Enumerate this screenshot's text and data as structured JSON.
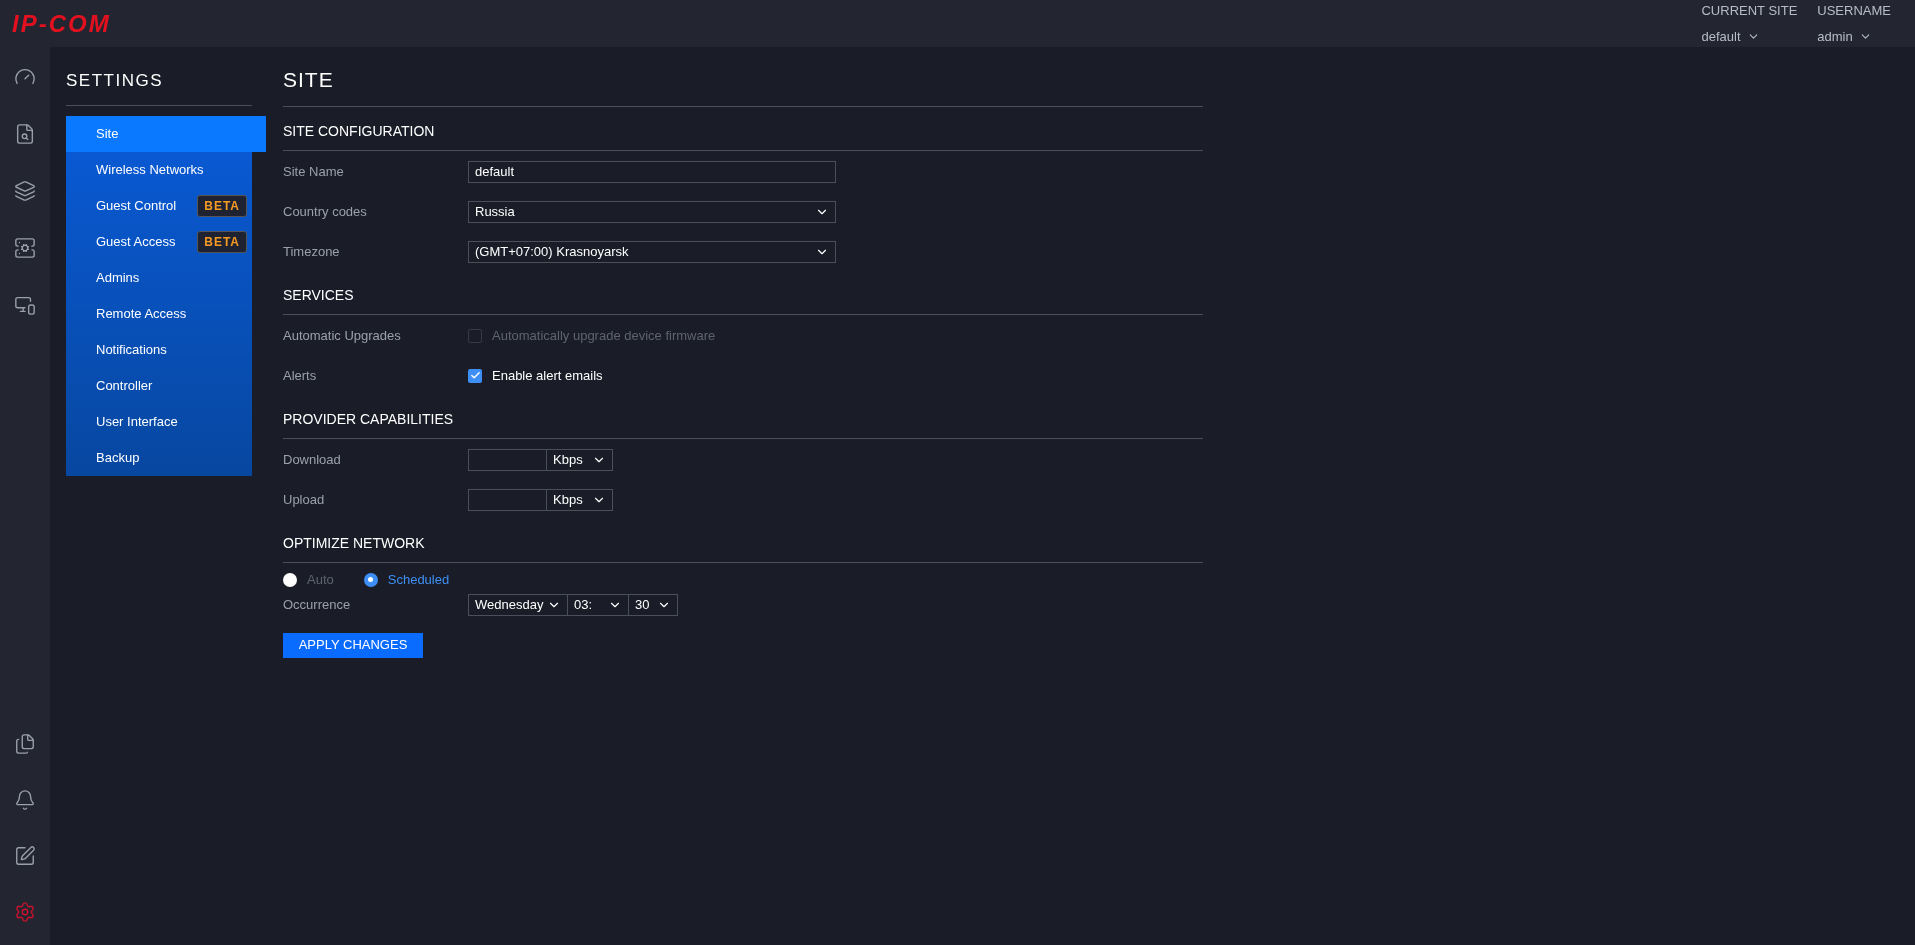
{
  "logo": {
    "text": "IP-COM"
  },
  "header": {
    "site_selector": {
      "label": "CURRENT SITE",
      "value": "default"
    },
    "user_menu": {
      "label": "USERNAME",
      "value": "admin"
    }
  },
  "nav_rail": {
    "top": [
      {
        "kind": "dashboard",
        "selected": false
      },
      {
        "kind": "insights",
        "selected": false
      },
      {
        "kind": "layers",
        "selected": false
      },
      {
        "kind": "devices",
        "selected": false
      },
      {
        "kind": "clients",
        "selected": false
      }
    ],
    "bottom": [
      {
        "kind": "logs",
        "selected": false
      },
      {
        "kind": "alerts",
        "selected": false
      },
      {
        "kind": "edit",
        "selected": false
      },
      {
        "kind": "settings",
        "selected": true
      }
    ]
  },
  "settings_menu": {
    "title": "SETTINGS",
    "items": [
      {
        "label": "Site",
        "selected": true
      },
      {
        "label": "Wireless Networks",
        "selected": false
      },
      {
        "label": "Guest Control",
        "selected": false,
        "badge": "BETA"
      },
      {
        "label": "Guest Access",
        "selected": false,
        "badge": "BETA"
      },
      {
        "label": "Admins",
        "selected": false
      },
      {
        "label": "Remote Access",
        "selected": false
      },
      {
        "label": "Notifications",
        "selected": false
      },
      {
        "label": "Controller",
        "selected": false
      },
      {
        "label": "User Interface",
        "selected": false
      },
      {
        "label": "Backup",
        "selected": false
      }
    ]
  },
  "page_title": "SITE",
  "sections": [
    {
      "title": "SITE CONFIGURATION",
      "rows": [
        {
          "kind": "text",
          "label": "Site Name",
          "value": "default"
        },
        {
          "kind": "select",
          "label": "Country codes",
          "value": "Russia"
        },
        {
          "kind": "select",
          "label": "Timezone",
          "value": "(GMT+07:00) Krasnoyarsk"
        }
      ]
    },
    {
      "title": "SERVICES",
      "rows": [
        {
          "kind": "checkbox",
          "label": "Automatic Upgrades",
          "text": "Automatically upgrade device firmware",
          "checked": false,
          "disabled": true
        },
        {
          "kind": "checkbox",
          "label": "Alerts",
          "text": "Enable alert emails",
          "checked": true,
          "disabled": false
        }
      ]
    },
    {
      "title": "PROVIDER CAPABILITIES",
      "rows": [
        {
          "kind": "rate",
          "label": "Download",
          "unit": "Kbps"
        },
        {
          "kind": "rate",
          "label": "Upload",
          "unit": "Kbps"
        }
      ]
    },
    {
      "title": "OPTIMIZE NETWORK",
      "rows": [
        {
          "kind": "radio",
          "options": [
            {
              "label": "Auto",
              "selected": false
            },
            {
              "label": "Scheduled",
              "selected": true
            }
          ]
        },
        {
          "kind": "schedule",
          "label": "Occurrence",
          "day": "Wednesday",
          "hour": "03:",
          "minute": "30"
        }
      ]
    }
  ],
  "apply_button": "APPLY CHANGES"
}
